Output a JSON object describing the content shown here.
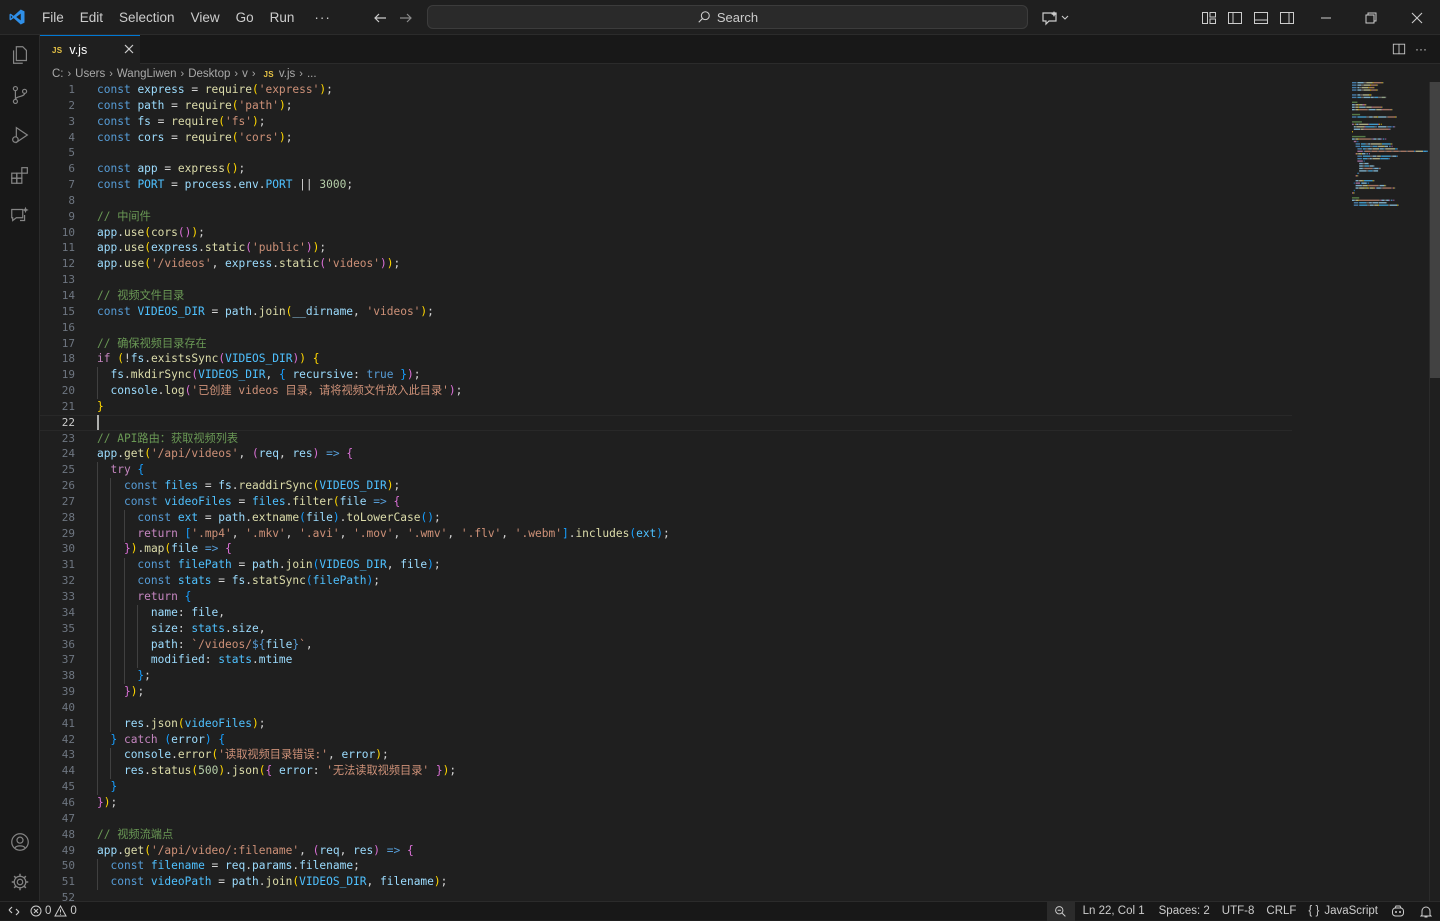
{
  "menu": [
    "File",
    "Edit",
    "Selection",
    "View",
    "Go",
    "Run",
    "···"
  ],
  "search_placeholder": "Search",
  "tab": {
    "badge": "JS",
    "name": "v.js"
  },
  "breadcrumb": [
    "C:",
    "Users",
    "WangLiwen",
    "Desktop",
    "v",
    "v.js",
    "..."
  ],
  "breadcrumb_js_badge": "JS",
  "editor": {
    "current_line": 22,
    "total_lines_visible": 52
  },
  "code_lines": [
    [
      [
        "k",
        "const"
      ],
      [
        "pl",
        " "
      ],
      [
        "v",
        "express"
      ],
      [
        "pl",
        " = "
      ],
      [
        "f",
        "require"
      ],
      [
        "p",
        "("
      ],
      [
        "s",
        "'express'"
      ],
      [
        "p",
        ")"
      ],
      [
        "pl",
        ";"
      ]
    ],
    [
      [
        "k",
        "const"
      ],
      [
        "pl",
        " "
      ],
      [
        "v",
        "path"
      ],
      [
        "pl",
        " = "
      ],
      [
        "f",
        "require"
      ],
      [
        "p",
        "("
      ],
      [
        "s",
        "'path'"
      ],
      [
        "p",
        ")"
      ],
      [
        "pl",
        ";"
      ]
    ],
    [
      [
        "k",
        "const"
      ],
      [
        "pl",
        " "
      ],
      [
        "v",
        "fs"
      ],
      [
        "pl",
        " = "
      ],
      [
        "f",
        "require"
      ],
      [
        "p",
        "("
      ],
      [
        "s",
        "'fs'"
      ],
      [
        "p",
        ")"
      ],
      [
        "pl",
        ";"
      ]
    ],
    [
      [
        "k",
        "const"
      ],
      [
        "pl",
        " "
      ],
      [
        "v",
        "cors"
      ],
      [
        "pl",
        " = "
      ],
      [
        "f",
        "require"
      ],
      [
        "p",
        "("
      ],
      [
        "s",
        "'cors'"
      ],
      [
        "p",
        ")"
      ],
      [
        "pl",
        ";"
      ]
    ],
    [],
    [
      [
        "k",
        "const"
      ],
      [
        "pl",
        " "
      ],
      [
        "v",
        "app"
      ],
      [
        "pl",
        " = "
      ],
      [
        "f",
        "express"
      ],
      [
        "p",
        "()"
      ],
      [
        "pl",
        ";"
      ]
    ],
    [
      [
        "k",
        "const"
      ],
      [
        "pl",
        " "
      ],
      [
        "c",
        "PORT"
      ],
      [
        "pl",
        " = "
      ],
      [
        "v",
        "process"
      ],
      [
        "pl",
        "."
      ],
      [
        "v",
        "env"
      ],
      [
        "pl",
        "."
      ],
      [
        "c",
        "PORT"
      ],
      [
        "pl",
        " || "
      ],
      [
        "n",
        "3000"
      ],
      [
        "pl",
        ";"
      ]
    ],
    [],
    [
      [
        "cm",
        "// 中间件"
      ]
    ],
    [
      [
        "v",
        "app"
      ],
      [
        "pl",
        "."
      ],
      [
        "f",
        "use"
      ],
      [
        "p",
        "("
      ],
      [
        "f",
        "cors"
      ],
      [
        "pu",
        "()"
      ],
      [
        "p",
        ")"
      ],
      [
        "pl",
        ";"
      ]
    ],
    [
      [
        "v",
        "app"
      ],
      [
        "pl",
        "."
      ],
      [
        "f",
        "use"
      ],
      [
        "p",
        "("
      ],
      [
        "v",
        "express"
      ],
      [
        "pl",
        "."
      ],
      [
        "f",
        "static"
      ],
      [
        "pu",
        "("
      ],
      [
        "s",
        "'public'"
      ],
      [
        "pu",
        ")"
      ],
      [
        "p",
        ")"
      ],
      [
        "pl",
        ";"
      ]
    ],
    [
      [
        "v",
        "app"
      ],
      [
        "pl",
        "."
      ],
      [
        "f",
        "use"
      ],
      [
        "p",
        "("
      ],
      [
        "s",
        "'/videos'"
      ],
      [
        "pl",
        ", "
      ],
      [
        "v",
        "express"
      ],
      [
        "pl",
        "."
      ],
      [
        "f",
        "static"
      ],
      [
        "pu",
        "("
      ],
      [
        "s",
        "'videos'"
      ],
      [
        "pu",
        ")"
      ],
      [
        "p",
        ")"
      ],
      [
        "pl",
        ";"
      ]
    ],
    [],
    [
      [
        "cm",
        "// 视频文件目录"
      ]
    ],
    [
      [
        "k",
        "const"
      ],
      [
        "pl",
        " "
      ],
      [
        "c",
        "VIDEOS_DIR"
      ],
      [
        "pl",
        " = "
      ],
      [
        "v",
        "path"
      ],
      [
        "pl",
        "."
      ],
      [
        "f",
        "join"
      ],
      [
        "p",
        "("
      ],
      [
        "v",
        "__dirname"
      ],
      [
        "pl",
        ", "
      ],
      [
        "s",
        "'videos'"
      ],
      [
        "p",
        ")"
      ],
      [
        "pl",
        ";"
      ]
    ],
    [],
    [
      [
        "cm",
        "// 确保视频目录存在"
      ]
    ],
    [
      [
        "kw",
        "if"
      ],
      [
        "pl",
        " "
      ],
      [
        "p",
        "("
      ],
      [
        "pl",
        "!"
      ],
      [
        "v",
        "fs"
      ],
      [
        "pl",
        "."
      ],
      [
        "f",
        "existsSync"
      ],
      [
        "pu",
        "("
      ],
      [
        "c",
        "VIDEOS_DIR"
      ],
      [
        "pu",
        ")"
      ],
      [
        "p",
        ")"
      ],
      [
        "pl",
        " "
      ],
      [
        "p",
        "{"
      ]
    ],
    [
      [
        "pl",
        "  "
      ],
      [
        "v",
        "fs"
      ],
      [
        "pl",
        "."
      ],
      [
        "f",
        "mkdirSync"
      ],
      [
        "pu",
        "("
      ],
      [
        "c",
        "VIDEOS_DIR"
      ],
      [
        "pl",
        ", "
      ],
      [
        "bl",
        "{"
      ],
      [
        "pl",
        " "
      ],
      [
        "v",
        "recursive"
      ],
      [
        "pl",
        ": "
      ],
      [
        "k",
        "true"
      ],
      [
        "pl",
        " "
      ],
      [
        "bl",
        "}"
      ],
      [
        "pu",
        ")"
      ],
      [
        "pl",
        ";"
      ]
    ],
    [
      [
        "pl",
        "  "
      ],
      [
        "v",
        "console"
      ],
      [
        "pl",
        "."
      ],
      [
        "f",
        "log"
      ],
      [
        "pu",
        "("
      ],
      [
        "s",
        "'已创建 videos 目录，请将视频文件放入此目录'"
      ],
      [
        "pu",
        ")"
      ],
      [
        "pl",
        ";"
      ]
    ],
    [
      [
        "p",
        "}"
      ]
    ],
    [],
    [
      [
        "cm",
        "// API路由：获取视频列表"
      ]
    ],
    [
      [
        "v",
        "app"
      ],
      [
        "pl",
        "."
      ],
      [
        "f",
        "get"
      ],
      [
        "p",
        "("
      ],
      [
        "s",
        "'/api/videos'"
      ],
      [
        "pl",
        ", "
      ],
      [
        "pu",
        "("
      ],
      [
        "v",
        "req"
      ],
      [
        "pl",
        ", "
      ],
      [
        "v",
        "res"
      ],
      [
        "pu",
        ")"
      ],
      [
        "pl",
        " "
      ],
      [
        "k",
        "=>"
      ],
      [
        "pl",
        " "
      ],
      [
        "pu",
        "{"
      ]
    ],
    [
      [
        "pl",
        "  "
      ],
      [
        "kw",
        "try"
      ],
      [
        "pl",
        " "
      ],
      [
        "bl",
        "{"
      ]
    ],
    [
      [
        "pl",
        "    "
      ],
      [
        "k",
        "const"
      ],
      [
        "pl",
        " "
      ],
      [
        "c",
        "files"
      ],
      [
        "pl",
        " = "
      ],
      [
        "v",
        "fs"
      ],
      [
        "pl",
        "."
      ],
      [
        "f",
        "readdirSync"
      ],
      [
        "p",
        "("
      ],
      [
        "c",
        "VIDEOS_DIR"
      ],
      [
        "p",
        ")"
      ],
      [
        "pl",
        ";"
      ]
    ],
    [
      [
        "pl",
        "    "
      ],
      [
        "k",
        "const"
      ],
      [
        "pl",
        " "
      ],
      [
        "c",
        "videoFiles"
      ],
      [
        "pl",
        " = "
      ],
      [
        "c",
        "files"
      ],
      [
        "pl",
        "."
      ],
      [
        "f",
        "filter"
      ],
      [
        "p",
        "("
      ],
      [
        "v",
        "file"
      ],
      [
        "pl",
        " "
      ],
      [
        "k",
        "=>"
      ],
      [
        "pl",
        " "
      ],
      [
        "pu",
        "{"
      ]
    ],
    [
      [
        "pl",
        "      "
      ],
      [
        "k",
        "const"
      ],
      [
        "pl",
        " "
      ],
      [
        "c",
        "ext"
      ],
      [
        "pl",
        " = "
      ],
      [
        "v",
        "path"
      ],
      [
        "pl",
        "."
      ],
      [
        "f",
        "extname"
      ],
      [
        "bl",
        "("
      ],
      [
        "v",
        "file"
      ],
      [
        "bl",
        ")"
      ],
      [
        "pl",
        "."
      ],
      [
        "f",
        "toLowerCase"
      ],
      [
        "bl",
        "()"
      ],
      [
        "pl",
        ";"
      ]
    ],
    [
      [
        "pl",
        "      "
      ],
      [
        "kw",
        "return"
      ],
      [
        "pl",
        " "
      ],
      [
        "bl",
        "["
      ],
      [
        "s",
        "'.mp4'"
      ],
      [
        "pl",
        ", "
      ],
      [
        "s",
        "'.mkv'"
      ],
      [
        "pl",
        ", "
      ],
      [
        "s",
        "'.avi'"
      ],
      [
        "pl",
        ", "
      ],
      [
        "s",
        "'.mov'"
      ],
      [
        "pl",
        ", "
      ],
      [
        "s",
        "'.wmv'"
      ],
      [
        "pl",
        ", "
      ],
      [
        "s",
        "'.flv'"
      ],
      [
        "pl",
        ", "
      ],
      [
        "s",
        "'.webm'"
      ],
      [
        "bl",
        "]"
      ],
      [
        "pl",
        "."
      ],
      [
        "f",
        "includes"
      ],
      [
        "bl",
        "("
      ],
      [
        "c",
        "ext"
      ],
      [
        "bl",
        ")"
      ],
      [
        "pl",
        ";"
      ]
    ],
    [
      [
        "pl",
        "    "
      ],
      [
        "pu",
        "}"
      ],
      [
        "p",
        ")"
      ],
      [
        "pl",
        "."
      ],
      [
        "f",
        "map"
      ],
      [
        "p",
        "("
      ],
      [
        "v",
        "file"
      ],
      [
        "pl",
        " "
      ],
      [
        "k",
        "=>"
      ],
      [
        "pl",
        " "
      ],
      [
        "pu",
        "{"
      ]
    ],
    [
      [
        "pl",
        "      "
      ],
      [
        "k",
        "const"
      ],
      [
        "pl",
        " "
      ],
      [
        "c",
        "filePath"
      ],
      [
        "pl",
        " = "
      ],
      [
        "v",
        "path"
      ],
      [
        "pl",
        "."
      ],
      [
        "f",
        "join"
      ],
      [
        "bl",
        "("
      ],
      [
        "c",
        "VIDEOS_DIR"
      ],
      [
        "pl",
        ", "
      ],
      [
        "v",
        "file"
      ],
      [
        "bl",
        ")"
      ],
      [
        "pl",
        ";"
      ]
    ],
    [
      [
        "pl",
        "      "
      ],
      [
        "k",
        "const"
      ],
      [
        "pl",
        " "
      ],
      [
        "c",
        "stats"
      ],
      [
        "pl",
        " = "
      ],
      [
        "v",
        "fs"
      ],
      [
        "pl",
        "."
      ],
      [
        "f",
        "statSync"
      ],
      [
        "bl",
        "("
      ],
      [
        "c",
        "filePath"
      ],
      [
        "bl",
        ")"
      ],
      [
        "pl",
        ";"
      ]
    ],
    [
      [
        "pl",
        "      "
      ],
      [
        "kw",
        "return"
      ],
      [
        "pl",
        " "
      ],
      [
        "bl",
        "{"
      ]
    ],
    [
      [
        "pl",
        "        "
      ],
      [
        "v",
        "name"
      ],
      [
        "pl",
        ": "
      ],
      [
        "v",
        "file"
      ],
      [
        "pl",
        ","
      ]
    ],
    [
      [
        "pl",
        "        "
      ],
      [
        "v",
        "size"
      ],
      [
        "pl",
        ": "
      ],
      [
        "c",
        "stats"
      ],
      [
        "pl",
        "."
      ],
      [
        "v",
        "size"
      ],
      [
        "pl",
        ","
      ]
    ],
    [
      [
        "pl",
        "        "
      ],
      [
        "v",
        "path"
      ],
      [
        "pl",
        ": "
      ],
      [
        "s",
        "`/videos/"
      ],
      [
        "k",
        "${"
      ],
      [
        "v",
        "file"
      ],
      [
        "k",
        "}"
      ],
      [
        "s",
        "`"
      ],
      [
        "pl",
        ","
      ]
    ],
    [
      [
        "pl",
        "        "
      ],
      [
        "v",
        "modified"
      ],
      [
        "pl",
        ": "
      ],
      [
        "c",
        "stats"
      ],
      [
        "pl",
        "."
      ],
      [
        "v",
        "mtime"
      ]
    ],
    [
      [
        "pl",
        "      "
      ],
      [
        "bl",
        "}"
      ],
      [
        "pl",
        ";"
      ]
    ],
    [
      [
        "pl",
        "    "
      ],
      [
        "pu",
        "}"
      ],
      [
        "p",
        ")"
      ],
      [
        "pl",
        ";"
      ]
    ],
    [],
    [
      [
        "pl",
        "    "
      ],
      [
        "v",
        "res"
      ],
      [
        "pl",
        "."
      ],
      [
        "f",
        "json"
      ],
      [
        "p",
        "("
      ],
      [
        "c",
        "videoFiles"
      ],
      [
        "p",
        ")"
      ],
      [
        "pl",
        ";"
      ]
    ],
    [
      [
        "pl",
        "  "
      ],
      [
        "bl",
        "}"
      ],
      [
        "pl",
        " "
      ],
      [
        "kw",
        "catch"
      ],
      [
        "pl",
        " "
      ],
      [
        "bl",
        "("
      ],
      [
        "v",
        "error"
      ],
      [
        "bl",
        ")"
      ],
      [
        "pl",
        " "
      ],
      [
        "bl",
        "{"
      ]
    ],
    [
      [
        "pl",
        "    "
      ],
      [
        "v",
        "console"
      ],
      [
        "pl",
        "."
      ],
      [
        "f",
        "error"
      ],
      [
        "p",
        "("
      ],
      [
        "s",
        "'读取视频目录错误:'"
      ],
      [
        "pl",
        ", "
      ],
      [
        "v",
        "error"
      ],
      [
        "p",
        ")"
      ],
      [
        "pl",
        ";"
      ]
    ],
    [
      [
        "pl",
        "    "
      ],
      [
        "v",
        "res"
      ],
      [
        "pl",
        "."
      ],
      [
        "f",
        "status"
      ],
      [
        "p",
        "("
      ],
      [
        "n",
        "500"
      ],
      [
        "p",
        ")"
      ],
      [
        "pl",
        "."
      ],
      [
        "f",
        "json"
      ],
      [
        "p",
        "("
      ],
      [
        "pu",
        "{"
      ],
      [
        "pl",
        " "
      ],
      [
        "v",
        "error"
      ],
      [
        "pl",
        ": "
      ],
      [
        "s",
        "'无法读取视频目录'"
      ],
      [
        "pl",
        " "
      ],
      [
        "pu",
        "}"
      ],
      [
        "p",
        ")"
      ],
      [
        "pl",
        ";"
      ]
    ],
    [
      [
        "pl",
        "  "
      ],
      [
        "bl",
        "}"
      ]
    ],
    [
      [
        "pu",
        "}"
      ],
      [
        "p",
        ")"
      ],
      [
        "pl",
        ";"
      ]
    ],
    [],
    [
      [
        "cm",
        "// 视频流端点"
      ]
    ],
    [
      [
        "v",
        "app"
      ],
      [
        "pl",
        "."
      ],
      [
        "f",
        "get"
      ],
      [
        "p",
        "("
      ],
      [
        "s",
        "'/api/video/:filename'"
      ],
      [
        "pl",
        ", "
      ],
      [
        "pu",
        "("
      ],
      [
        "v",
        "req"
      ],
      [
        "pl",
        ", "
      ],
      [
        "v",
        "res"
      ],
      [
        "pu",
        ")"
      ],
      [
        "pl",
        " "
      ],
      [
        "k",
        "=>"
      ],
      [
        "pl",
        " "
      ],
      [
        "pu",
        "{"
      ]
    ],
    [
      [
        "pl",
        "  "
      ],
      [
        "k",
        "const"
      ],
      [
        "pl",
        " "
      ],
      [
        "c",
        "filename"
      ],
      [
        "pl",
        " = "
      ],
      [
        "v",
        "req"
      ],
      [
        "pl",
        "."
      ],
      [
        "v",
        "params"
      ],
      [
        "pl",
        "."
      ],
      [
        "v",
        "filename"
      ],
      [
        "pl",
        ";"
      ]
    ],
    [
      [
        "pl",
        "  "
      ],
      [
        "k",
        "const"
      ],
      [
        "pl",
        " "
      ],
      [
        "c",
        "videoPath"
      ],
      [
        "pl",
        " = "
      ],
      [
        "v",
        "path"
      ],
      [
        "pl",
        "."
      ],
      [
        "f",
        "join"
      ],
      [
        "p",
        "("
      ],
      [
        "c",
        "VIDEOS_DIR"
      ],
      [
        "pl",
        ", "
      ],
      [
        "v",
        "filename"
      ],
      [
        "p",
        ")"
      ],
      [
        "pl",
        ";"
      ]
    ],
    []
  ],
  "status": {
    "errors": "0",
    "warnings": "0",
    "position": "Ln 22, Col 1",
    "spaces": "Spaces: 2",
    "encoding": "UTF-8",
    "eol": "CRLF",
    "language_icon": "{ }",
    "language": "JavaScript"
  },
  "icons": [
    "vscode-logo-icon",
    "explorer-icon",
    "source-control-icon",
    "run-debug-icon",
    "extensions-icon",
    "chat-icon",
    "accounts-icon",
    "manage-gear-icon"
  ],
  "colors": {
    "accent": "#0078d4",
    "keyword": "#569cd6",
    "string": "#ce9178",
    "comment": "#6a9955",
    "function": "#dcdcaa"
  }
}
